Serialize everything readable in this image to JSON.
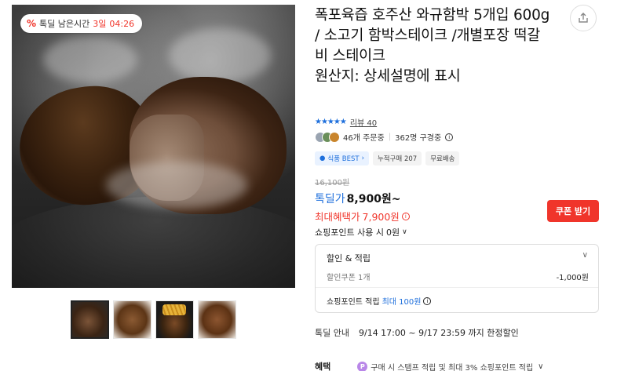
{
  "timer": {
    "label": "톡딜 남은시간",
    "days": "3일",
    "time": "04:26"
  },
  "product": {
    "title": "폭포육즙 호주산 와규함박 5개입 600g / 소고기 함박스테이크 /개별포장 떡갈비 스테이크",
    "origin": "원산지: 상세설명에 표시"
  },
  "rating": {
    "stars": "★★★★★",
    "review_label": "리뷰 40"
  },
  "buyers": {
    "orders": "46개 주문중",
    "subscribers": "362명 구경중"
  },
  "tags": [
    "식품 BEST",
    "누적구매 207",
    "무료배송"
  ],
  "price": {
    "original": "16,100원",
    "deal_label": "톡딜가",
    "deal_value": "8,900원~",
    "max_label": "최대혜택가",
    "max_value": "7,900원"
  },
  "coupon_button": "쿠폰 받기",
  "point_use": "쇼핑포인트 사용 시",
  "point_use_value": "0원",
  "discount_box": {
    "title": "할인 & 적립",
    "coupon_label": "할인쿠폰 1개",
    "coupon_value": "-1,000원",
    "point_label": "쇼핑포인트 적립",
    "point_value": "최대 100원"
  },
  "deal_info": {
    "label": "톡딜 안내",
    "period": "9/14 17:00 ~ 9/17 23:59 까지 한정할인"
  },
  "benefit": {
    "label": "혜택",
    "text": "구매 시 스탬프 적립 및 최대 3% 쇼핑포인트 적립"
  },
  "colors": {
    "accent_red": "#f0352b",
    "accent_blue": "#1e6fdc"
  },
  "icons": [
    "percent-icon",
    "share-icon",
    "info-icon",
    "chevron-down-icon",
    "point-icon"
  ]
}
